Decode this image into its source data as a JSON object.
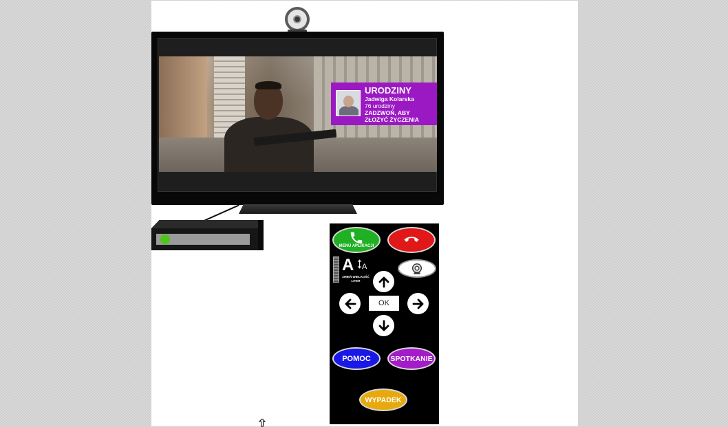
{
  "birthday": {
    "title": "URODZINY",
    "name": "Jadwiga Kolarska",
    "age": "76 urodziny",
    "message_line1": "ZADZWOŃ, ABY",
    "message_line2": "ZŁOŻYĆ ŻYCZENIA"
  },
  "remote": {
    "call_label": "MENU APLIKACJI",
    "font_label": "ZMIEŃ WIELKOŚĆ LITER",
    "font_icon_large": "A",
    "font_icon_small": "A",
    "ok_label": "OK",
    "help_label": "POMOC",
    "meeting_label": "SPOTKANIE",
    "accident_label": "WYPADEK"
  },
  "icons": {
    "webcam": "webcam-icon",
    "call": "phone-icon",
    "hangup": "hang-up-icon",
    "camera": "camera-icon",
    "font_size": "font-size-icon",
    "up": "arrow-up-icon",
    "down": "arrow-down-icon",
    "left": "arrow-left-icon",
    "right": "arrow-right-icon",
    "cursor": "cursor-icon"
  },
  "colors": {
    "call": "#1fb123",
    "hangup": "#e01818",
    "help": "#1a18e6",
    "meeting": "#a31cc8",
    "accident": "#e8a90f",
    "birthday_banner": "#9b19c2",
    "stb_led": "#50c41a"
  }
}
